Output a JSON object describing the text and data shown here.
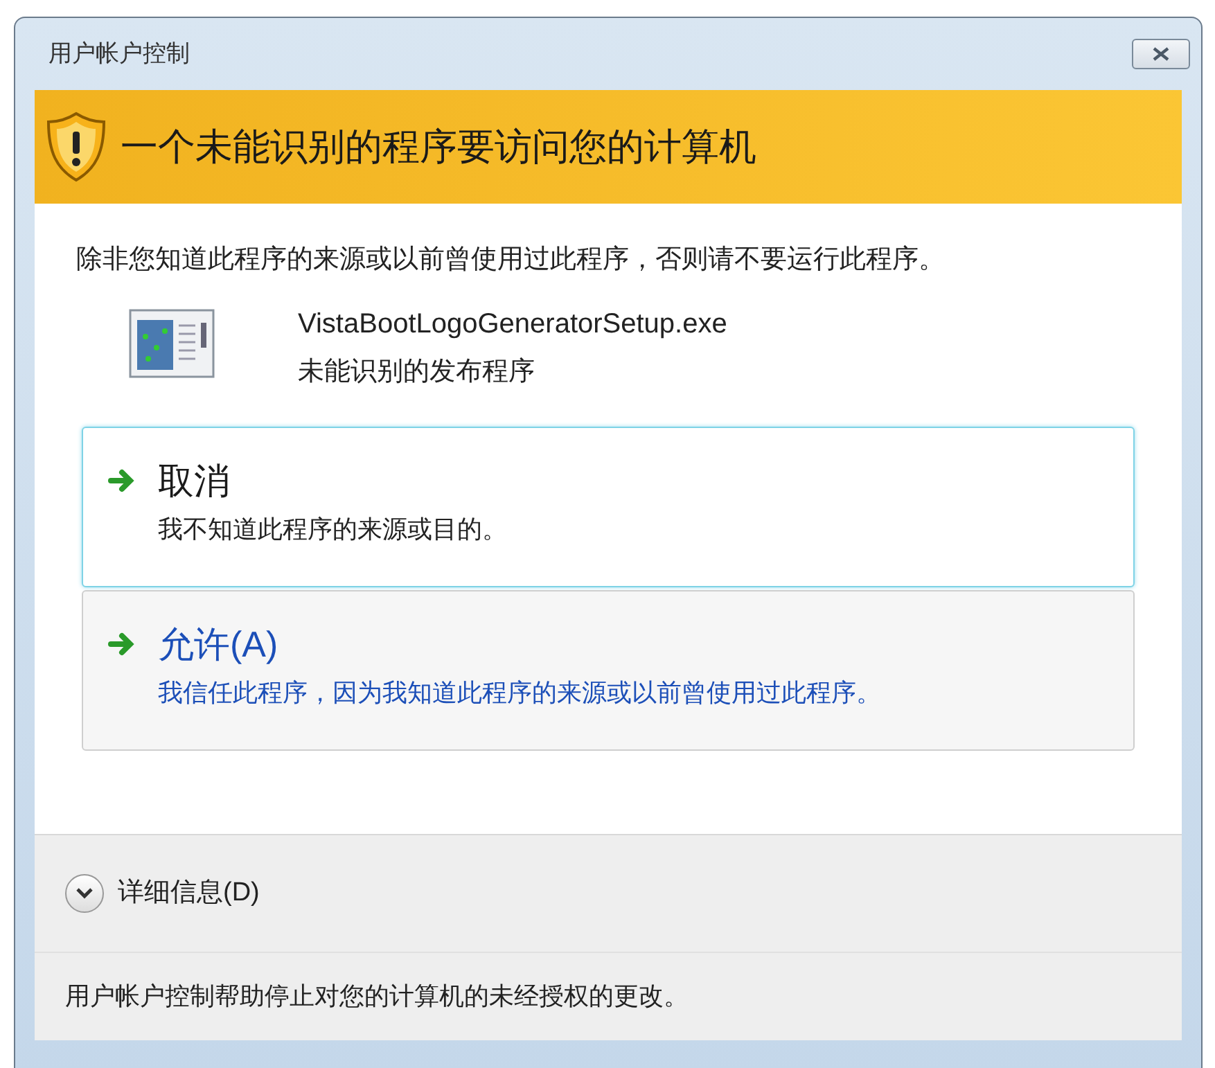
{
  "window": {
    "title": "用户帐户控制"
  },
  "banner": {
    "title": "一个未能识别的程序要访问您的计算机"
  },
  "message": "除非您知道此程序的来源或以前曾使用过此程序，否则请不要运行此程序。",
  "program": {
    "name": "VistaBootLogoGeneratorSetup.exe",
    "publisher": "未能识别的发布程序"
  },
  "options": [
    {
      "title": "取消",
      "description": "我不知道此程序的来源或目的。",
      "selected": true
    },
    {
      "title": "允许(A)",
      "description": "我信任此程序，因为我知道此程序的来源或以前曾使用过此程序。",
      "selected": false
    }
  ],
  "details": {
    "label": "详细信息(D)",
    "expanded": false
  },
  "footer": "用户帐户控制帮助停止对您的计算机的未经授权的更改。"
}
